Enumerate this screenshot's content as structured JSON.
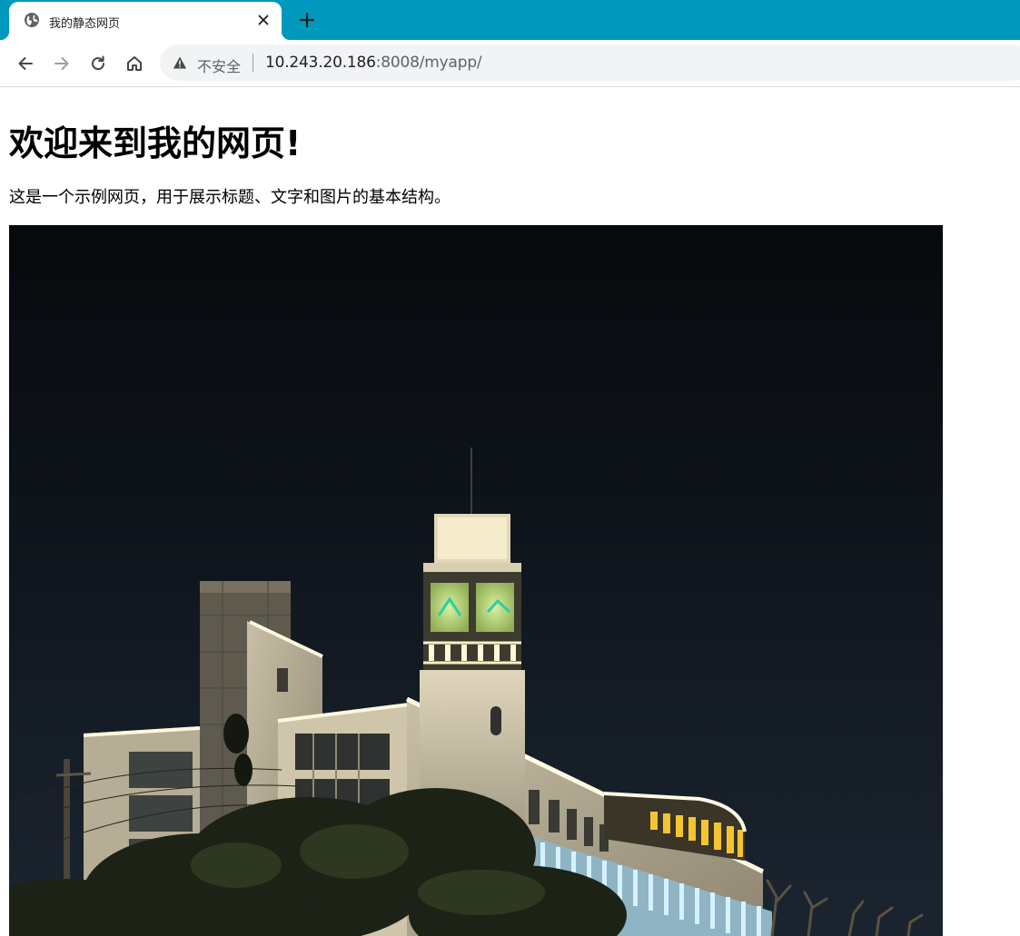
{
  "browser": {
    "tab": {
      "title": "我的静态网页",
      "favicon": "globe-icon"
    },
    "new_tab_icon": "plus-icon",
    "nav": {
      "back_icon": "arrow-left-icon",
      "forward_icon": "arrow-right-icon",
      "reload_icon": "reload-icon",
      "home_icon": "home-icon"
    },
    "address": {
      "security_icon": "warning-triangle-icon",
      "security_label": "不安全",
      "url_host": "10.243.20.186",
      "url_rest": ":8008/myapp/"
    },
    "accent": "#0099bd"
  },
  "page": {
    "heading": "欢迎来到我的网页!",
    "description": "这是一个示例网页，用于展示标题、文字和图片的基本结构。",
    "image": {
      "subject": "night view of an illuminated building with a clock tower"
    }
  }
}
